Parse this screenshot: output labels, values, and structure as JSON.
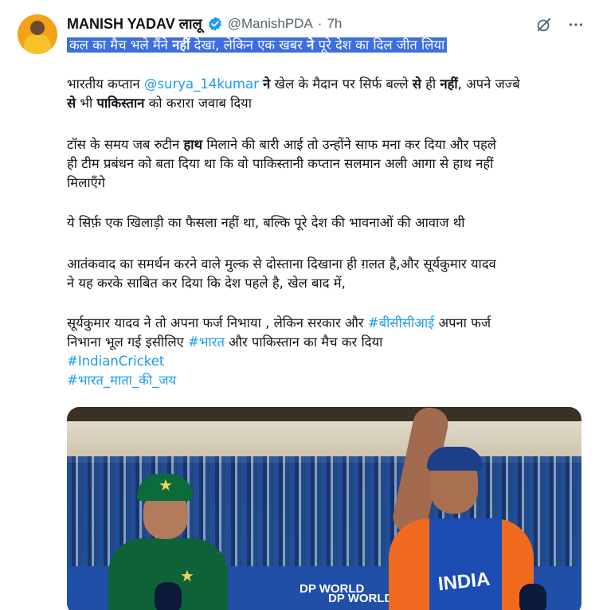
{
  "author": {
    "name": "MANISH YADAV लालू",
    "handle": "@ManishPDA",
    "separator": "·",
    "time": "7h"
  },
  "icons": {
    "verified": "verified-badge-icon",
    "grok": "grok-icon",
    "more": "more-options-icon"
  },
  "colors": {
    "highlight": "#3c6ee0",
    "link": "#1d9bf0",
    "verified": "#1d9bf0"
  },
  "tweet": {
    "line1": {
      "a": "कल का मैच भले मैंने ",
      "b": "नहीं",
      "c": " देखा, लेकिन एक खबर ",
      "d": "ने",
      "e": " पूरे देश का दिल जीत लिया"
    },
    "para1": {
      "a": "भारतीय कप्तान ",
      "mention": "@surya_14kumar",
      "b": "  ",
      "c": "ने",
      "d": " खेल के मैदान पर सिर्फ बल्ले ",
      "e": "से",
      "f": " ही ",
      "g": "नहीं",
      "h": ", अपने जज्बे",
      "i": "से",
      "j": " भी ",
      "k": "पाकिस्तान",
      "l": " को करारा जवाब दिया"
    },
    "para2": {
      "a": "टॉस के समय जब रुटीन ",
      "b": "हाथ",
      "c": " मिलाने की बारी आई तो उन्होंने साफ मना कर दिया और पहले",
      "d": "ही टीम प्रबंधन को बता दिया था कि वो पाकिस्तानी कप्तान सलमान अली आगा से हाथ नहीं",
      "e": "मिलाएँगे"
    },
    "para3": "ये सिर्फ़ एक खिलाड़ी का फैसला नहीं था, बल्कि पूरे देश की भावनाओं की आवाज थी",
    "para4": {
      "a": "आतंकवाद का समर्थन करने वाले मुल्क से दोस्ताना दिखाना ही ग़लत है,और सूर्यकुमार यादव",
      "b": "ने यह करके साबित कर दिया कि देश पहले है, खेल बाद में,"
    },
    "para5": {
      "a": "सूर्यकुमार यादव ने तो अपना फर्ज निभाया , लेकिन सरकार और ",
      "tag1": "#बीसीसीआई",
      "b": " अपना फर्ज",
      "c": "निभाना भूल गई इसीलिए ",
      "tag2": "#भारत",
      "d": " और पाकिस्तान का मैच कर दिया"
    },
    "hashtag1": "#IndianCricket",
    "hashtag2": "#भारत_माता_की_जय"
  },
  "media": {
    "board_text_1": "DP WORLD",
    "board_text_2": "DP WORLD",
    "jersey_text": "INDIA"
  }
}
